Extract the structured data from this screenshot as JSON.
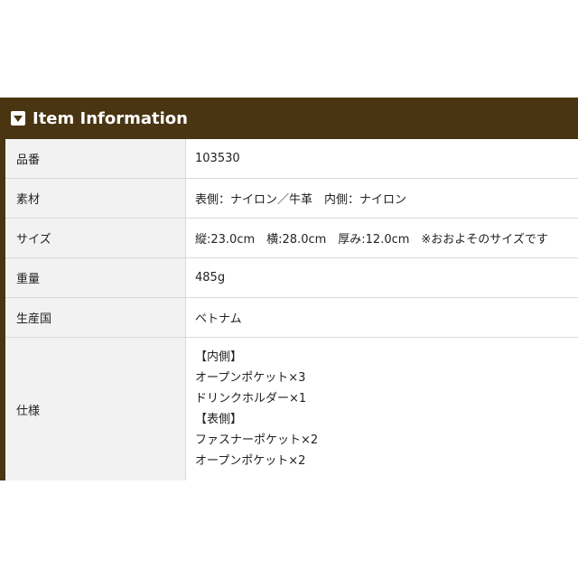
{
  "header": {
    "title": "Item Information",
    "icon": "triangle-down-icon",
    "background": "#4a3512"
  },
  "rows": [
    {
      "label": "品番",
      "value": "103530"
    },
    {
      "label": "素材",
      "value": "表側：ナイロン／牛革　内側：ナイロン"
    },
    {
      "label": "サイズ",
      "value": "縦:23.0cm　横:28.0cm　厚み:12.0cm　※おおよそのサイズです"
    },
    {
      "label": "重量",
      "value": "485g"
    },
    {
      "label": "生産国",
      "value": "ベトナム"
    },
    {
      "label": "仕様",
      "lines": [
        "【内側】",
        "オープンポケット×3",
        "ドリンクホルダー×1",
        "【表側】",
        "ファスナーポケット×2",
        "オープンポケット×2"
      ]
    }
  ]
}
